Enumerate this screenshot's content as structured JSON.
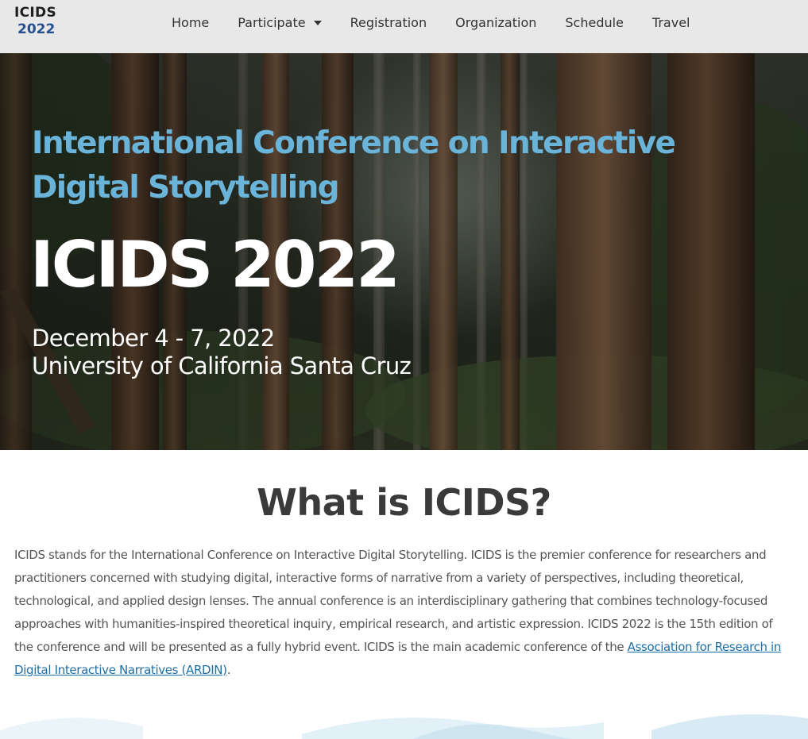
{
  "header": {
    "logo": {
      "line1": "ICIDS",
      "line2": "2022"
    },
    "nav": [
      {
        "label": "Home"
      },
      {
        "label": "Participate",
        "has_dropdown": true
      },
      {
        "label": "Registration"
      },
      {
        "label": "Organization"
      },
      {
        "label": "Schedule"
      },
      {
        "label": "Travel"
      }
    ]
  },
  "hero": {
    "subtitle": "International Conference on Interactive Digital Storytelling",
    "title": "ICIDS 2022",
    "dates": "December 4 - 7, 2022",
    "venue": "University of California Santa Cruz"
  },
  "about": {
    "heading": "What is ICIDS?",
    "body": "ICIDS stands for the International Conference on Interactive Digital Storytelling. ICIDS is the premier conference for researchers and practitioners concerned with studying digital, interactive forms of narrative from a variety of perspectives, including theoretical, technological, and applied design lenses. The annual conference is an interdisciplinary gathering that combines technology-focused approaches with humanities-inspired theoretical inquiry, empirical research, and artistic expression. ICIDS 2022 is the 15th edition of the conference and will be presented as a fully hybrid event. ICIDS is the main academic conference of the ",
    "link_text": "Association for Research in Digital Interactive Narratives (ARDIN)",
    "trailing": "."
  },
  "colors": {
    "header_bg": "#e8e8e8",
    "logo_accent": "#27508e",
    "subtitle": "#6ab3d9",
    "heading": "#3a3a3a",
    "link": "#1f6fa6"
  }
}
